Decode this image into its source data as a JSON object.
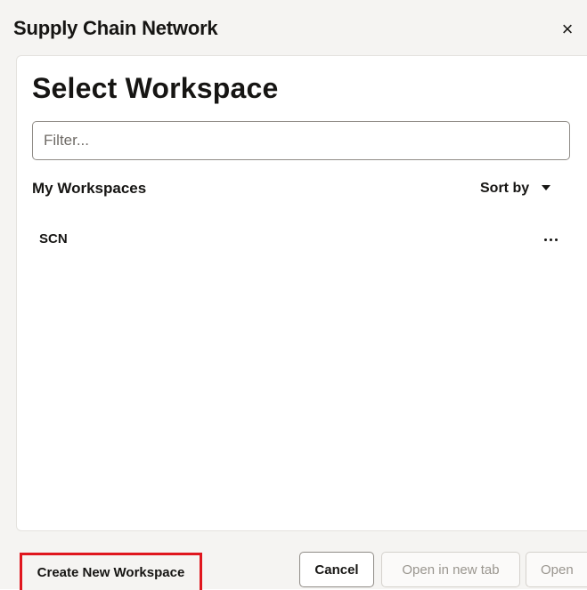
{
  "dialog": {
    "title": "Supply Chain Network",
    "close_icon": "close-icon",
    "close_glyph": "×"
  },
  "panel": {
    "title": "Select Workspace",
    "filter_placeholder": "Filter...",
    "section_label": "My Workspaces",
    "sort_label": "Sort by",
    "items": [
      {
        "label": "SCN",
        "actions_icon": "more-horizontal-icon"
      }
    ]
  },
  "footer": {
    "create_label": "Create New Workspace",
    "cancel_label": "Cancel",
    "open_new_tab_label": "Open in new tab",
    "open_label": "Open"
  },
  "colors": {
    "highlight": "#e0161e",
    "dialog_bg": "#f5f4f2",
    "panel_bg": "#ffffff",
    "disabled_text": "#9a968f"
  }
}
